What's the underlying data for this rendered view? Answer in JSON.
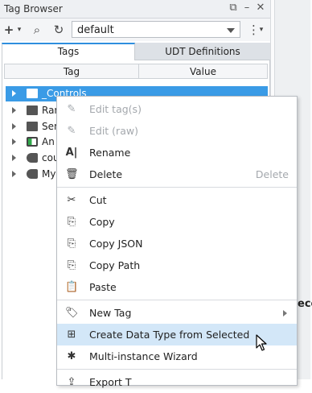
{
  "panel": {
    "title": "Tag Browser",
    "provider_value": "default",
    "tabs": [
      {
        "label": "Tags",
        "active": true
      },
      {
        "label": "UDT Definitions",
        "active": false
      }
    ],
    "columns": [
      "Tag",
      "Value"
    ]
  },
  "tree": [
    {
      "label": "_Controls",
      "icon": "folder-icon",
      "selected": true
    },
    {
      "label": "Ram",
      "icon": "folder-icon",
      "selected": false
    },
    {
      "label": "Sen",
      "icon": "folder-icon",
      "selected": false
    },
    {
      "label": "An I",
      "icon": "tag-icon",
      "selected": false
    },
    {
      "label": "cou",
      "icon": "udt-instance-icon",
      "selected": false
    },
    {
      "label": "My A",
      "icon": "udt-instance-icon",
      "selected": false
    }
  ],
  "side": {
    "partial_text": "eco"
  },
  "menu": {
    "items": [
      {
        "label": "Edit tag(s)",
        "icon": "pencil-icon",
        "disabled": true
      },
      {
        "label": "Edit (raw)",
        "icon": "pencil-icon",
        "disabled": true
      },
      {
        "label": "Rename",
        "icon": "rename-icon",
        "disabled": false
      },
      {
        "label": "Delete",
        "icon": "trash-icon",
        "disabled": false,
        "shortcut": "Delete"
      },
      {
        "label": "Cut",
        "icon": "scissors-icon",
        "disabled": false
      },
      {
        "label": "Copy",
        "icon": "copy-icon",
        "disabled": false
      },
      {
        "label": "Copy JSON",
        "icon": "copy-json-icon",
        "disabled": false
      },
      {
        "label": "Copy Path",
        "icon": "copy-path-icon",
        "disabled": false
      },
      {
        "label": "Paste",
        "icon": "paste-icon",
        "disabled": false
      },
      {
        "label": "New Tag",
        "icon": "new-tag-icon",
        "disabled": false,
        "submenu": true
      },
      {
        "label": "Create Data Type from Selected",
        "icon": "create-udt-icon",
        "disabled": false,
        "hover": true
      },
      {
        "label": "Multi-instance Wizard",
        "icon": "wizard-icon",
        "disabled": false
      },
      {
        "label": "Export T",
        "icon": "export-icon",
        "disabled": false
      }
    ]
  },
  "colors": {
    "selection": "#3a9be6",
    "menu_hover": "#d3e7f8",
    "tab_accent": "#2f8fde"
  }
}
